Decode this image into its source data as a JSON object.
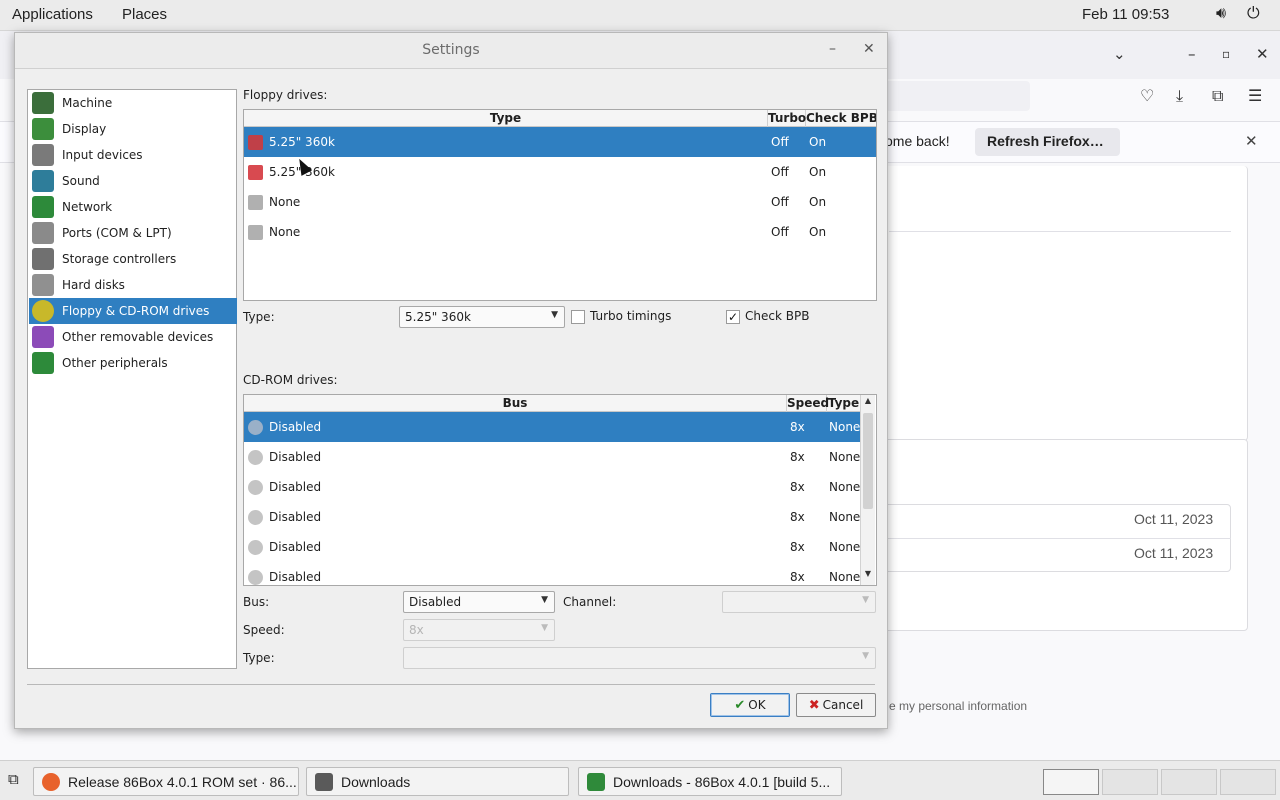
{
  "topbar": {
    "applications": "Applications",
    "places": "Places",
    "datetime": "Feb 11  09:53",
    "volume_icon": "speaker-icon",
    "power_icon": "power-icon"
  },
  "firefox": {
    "notice_text": "ome back!",
    "refresh_button": "Refresh Firefox…",
    "dates": [
      "Oct 11, 2023",
      "Oct 11, 2023"
    ],
    "footer_text": "e my personal information"
  },
  "taskbar": {
    "items": [
      {
        "label": "Release 86Box 4.0.1 ROM set · 86...",
        "icon": "firefox-icon",
        "color": "#e8622c"
      },
      {
        "label": "Downloads",
        "icon": "file-manager-icon",
        "color": "#5a5a5a"
      },
      {
        "label": "Downloads - 86Box 4.0.1 [build 5...",
        "icon": "86box-icon",
        "color": "#2f8a3a"
      }
    ]
  },
  "dialog": {
    "title": "Settings",
    "categories": [
      {
        "label": "Machine",
        "icon": "motherboard-icon",
        "color": "#3b6e3b"
      },
      {
        "label": "Display",
        "icon": "display-icon",
        "color": "#3c8e3c"
      },
      {
        "label": "Input devices",
        "icon": "keyboard-icon",
        "color": "#7a7a7a"
      },
      {
        "label": "Sound",
        "icon": "speaker-icon",
        "color": "#2e7d9a"
      },
      {
        "label": "Network",
        "icon": "network-icon",
        "color": "#2d8a3a"
      },
      {
        "label": "Ports (COM & LPT)",
        "icon": "ports-icon",
        "color": "#8a8a8a"
      },
      {
        "label": "Storage controllers",
        "icon": "storage-controller-icon",
        "color": "#707070"
      },
      {
        "label": "Hard disks",
        "icon": "hard-disk-icon",
        "color": "#909090"
      },
      {
        "label": "Floppy & CD-ROM drives",
        "icon": "floppy-cdrom-icon",
        "color": "#c8b82a"
      },
      {
        "label": "Other removable devices",
        "icon": "removable-device-icon",
        "color": "#8c4bb8"
      },
      {
        "label": "Other peripherals",
        "icon": "peripherals-icon",
        "color": "#2d8a3a"
      }
    ],
    "selected_category": "Floppy & CD-ROM drives",
    "floppy": {
      "section_label": "Floppy drives:",
      "columns": [
        "Type",
        "Turbo",
        "Check BPB"
      ],
      "rows": [
        {
          "type": "5.25\" 360k",
          "turbo": "Off",
          "check_bpb": "On",
          "icon": "floppy-disk-icon",
          "color": "#c04048"
        },
        {
          "type": "5.25\" 360k",
          "turbo": "Off",
          "check_bpb": "On",
          "icon": "floppy-disk-icon",
          "color": "#d84a50"
        },
        {
          "type": "None",
          "turbo": "Off",
          "check_bpb": "On",
          "icon": "floppy-disabled-icon",
          "color": "#b0b0b0"
        },
        {
          "type": "None",
          "turbo": "Off",
          "check_bpb": "On",
          "icon": "floppy-disabled-icon",
          "color": "#b0b0b0"
        }
      ],
      "type_label": "Type:",
      "type_value": "5.25\" 360k",
      "turbo_label": "Turbo timings",
      "turbo_checked": false,
      "checkbpb_label": "Check BPB",
      "checkbpb_checked": true
    },
    "cdrom": {
      "section_label": "CD-ROM drives:",
      "columns": [
        "Bus",
        "Speed",
        "Type"
      ],
      "rows": [
        {
          "bus": "Disabled",
          "speed": "8x",
          "type": "None"
        },
        {
          "bus": "Disabled",
          "speed": "8x",
          "type": "None"
        },
        {
          "bus": "Disabled",
          "speed": "8x",
          "type": "None"
        },
        {
          "bus": "Disabled",
          "speed": "8x",
          "type": "None"
        },
        {
          "bus": "Disabled",
          "speed": "8x",
          "type": "None"
        },
        {
          "bus": "Disabled",
          "speed": "8x",
          "type": "None"
        }
      ],
      "bus_label": "Bus:",
      "bus_value": "Disabled",
      "channel_label": "Channel:",
      "channel_value": "",
      "speed_label": "Speed:",
      "speed_value": "8x",
      "type_label": "Type:",
      "type_value": ""
    },
    "ok_label": "OK",
    "cancel_label": "Cancel"
  },
  "colors": {
    "selection": "#2f7fc1",
    "dialog_bg": "#efefef"
  }
}
